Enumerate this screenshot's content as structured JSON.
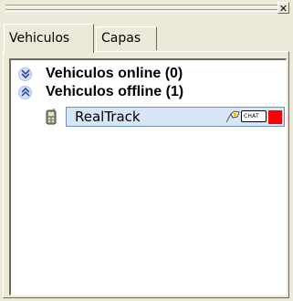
{
  "panel": {
    "close_glyph": "✕",
    "tabs": [
      {
        "label": "Vehiculos",
        "active": true
      },
      {
        "label": "Capas",
        "active": false
      }
    ]
  },
  "tree": {
    "groups": [
      {
        "label": "Vehiculos online (0)",
        "state": "collapsed",
        "icon": "chevron-double-down-icon"
      },
      {
        "label": "Vehiculos offline (1)",
        "state": "expanded",
        "icon": "chevron-double-up-icon"
      }
    ],
    "vehicles": [
      {
        "name": "RealTrack",
        "chat_label": "CHAT",
        "status_color": "#ff0000",
        "icon": "phone-icon"
      }
    ]
  }
}
